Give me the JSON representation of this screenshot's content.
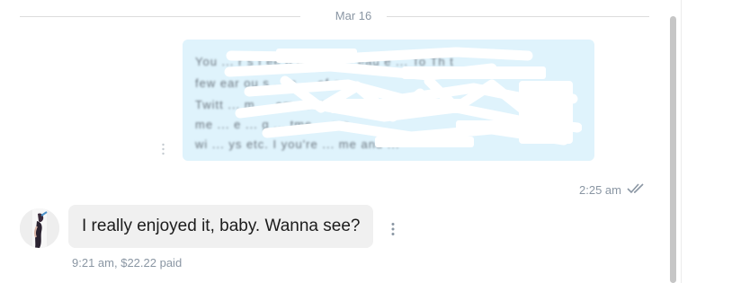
{
  "date_divider": "Mar 16",
  "outgoing": {
    "redacted_lines": [
      "You  ...  r s f ee   o mme  e  ...  eau e  ...  To    Th t",
      "few  ear   ou  s   ...  s   ...   of o  ...  ",
      "Twitt   ...   m  ...   om  ...   st   ...  acti   ...",
      "me   ...   e   ...   g   ...   tme  ...   wo  ..."
    ],
    "redacted_last_line": "wi   ...   ys  etc.  I   you're  ...   me and ...",
    "time": "2:25 am",
    "read_receipt_icon": "double-check-icon"
  },
  "incoming": {
    "text": "I really enjoyed it, baby. Wanna see?",
    "time": "9:21 am,",
    "price": "$22.22 paid",
    "avatar_icon": "user-avatar"
  },
  "colors": {
    "outgoing_bubble": "#dff3fc",
    "incoming_bubble": "#f0f0f0",
    "meta_text": "#8a96a3",
    "redaction": "#ffffff"
  }
}
